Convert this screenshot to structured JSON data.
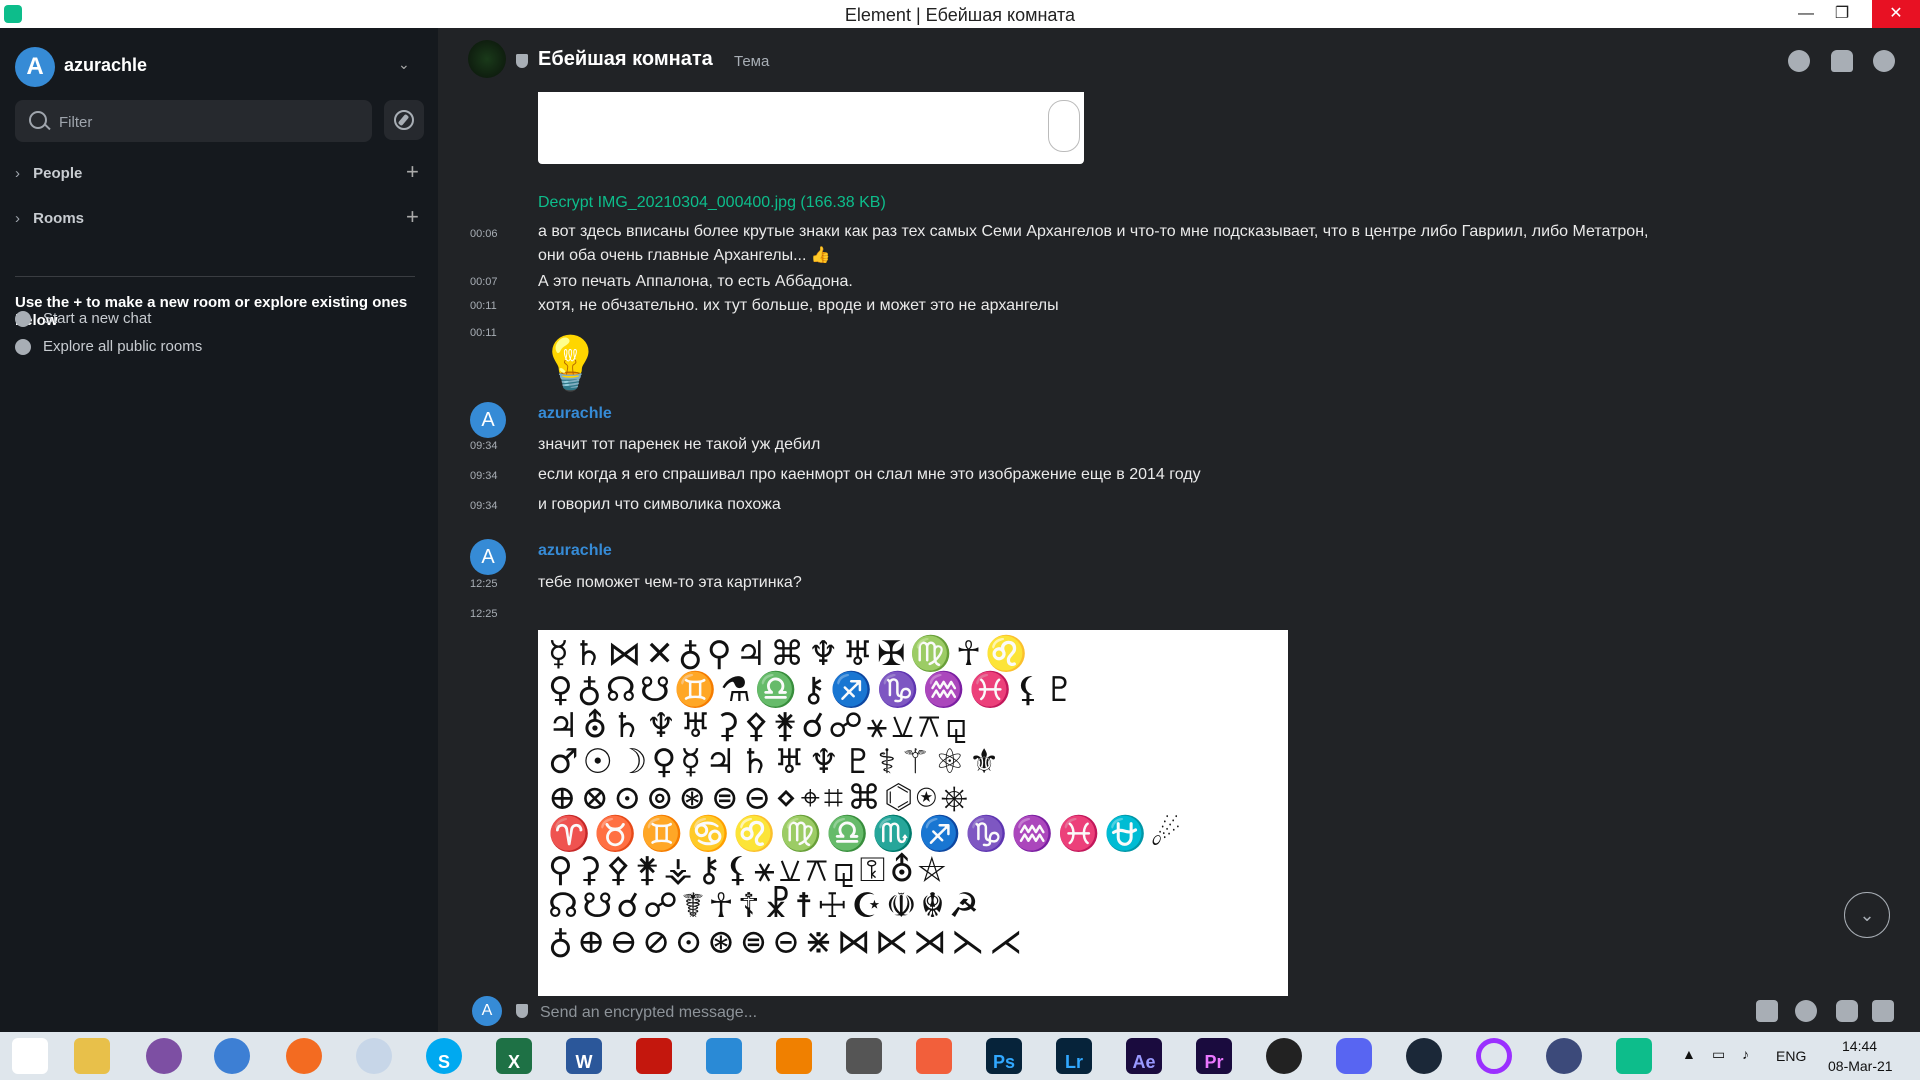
{
  "window": {
    "title": "Element | Ебейшая комната",
    "minimize": "—",
    "maximize": "❐",
    "close": "✕"
  },
  "sidebar": {
    "username": "azurachle",
    "avatar_letter": "A",
    "filter_placeholder": "Filter",
    "sections": [
      {
        "label": "People"
      },
      {
        "label": "Rooms"
      }
    ],
    "hint_title": "Use the + to make a new room or explore existing ones below",
    "actions": [
      {
        "label": "Start a new chat"
      },
      {
        "label": "Explore all public rooms"
      }
    ]
  },
  "room": {
    "name": "Ебейшая комната",
    "topic": "Тема"
  },
  "timeline": {
    "file_link": "Decrypt IMG_20210304_000400.jpg (166.38 KB)",
    "messages": [
      {
        "time": "00:06",
        "text": "а вот здесь вписаны более крутые знаки как раз тех самых Семи Архангелов и что-то мне подсказывает, что в центре либо Гавриил, либо Метатрон,",
        "text2": "они оба очень главные Архангелы... 👍"
      },
      {
        "time": "00:07",
        "text": "А это печать Аппалона, то есть Аббадона."
      },
      {
        "time": "00:11",
        "text": "хотя, не обчзательно. их тут больше, вроде и может это не архангелы"
      },
      {
        "time": "00:11",
        "emoji": "💡"
      }
    ],
    "group1": {
      "sender": "azurachle",
      "messages": [
        {
          "time": "09:34",
          "text": "значит тот паренек не такой уж дебил"
        },
        {
          "time": "09:34",
          "text": "если когда я его спрашивал про каенморт он слал мне это изображение еще в 2014 году"
        },
        {
          "time": "09:34",
          "text": "и говорил что символика похожа"
        }
      ]
    },
    "group2": {
      "sender": "azurachle",
      "messages": [
        {
          "time": "12:25",
          "text": "тебе поможет чем-то эта картинка?"
        },
        {
          "time": "12:25"
        }
      ],
      "symbols_image": "☿♄⋈✕♁⚲♃⌘♆♅✠♍☥♌\n♀♁☊☋♊⚗♎⚷♐♑♒♓⚸♇\n♃⛢♄♆♅⚳⚴⚵☌☍⚹⚺⚻⚼\n♂☉☽♀☿♃♄♅♆♇⚕⚚⚛⚜\n⊕⊗⊙⊚⊛⊜⊝⋄⌖⌗⌘⌬⍟⎈\n♈♉♊♋♌♍♎♏♐♑♒♓⛎☄\n⚲⚳⚴⚵⚶⚷⚸⚹⚺⚻⚼⚿⛢⛤\n☊☋☌☍☤☥☦☧☨☩☪☫☬☭\n♁⊕⊖⊘⊙⊛⊜⊝⋇⋈⋉⋊⋋⋌"
    }
  },
  "composer": {
    "placeholder": "Send an encrypted message..."
  },
  "taskbar": {
    "apps": [
      "start",
      "explorer",
      "tor",
      "browser",
      "firefox",
      "app",
      "skype",
      "excel",
      "word",
      "acrobat",
      "vscode",
      "vlc",
      "download",
      "sublime",
      "photoshop",
      "lightroom",
      "aftereffects",
      "premiere",
      "obs",
      "discord",
      "steam",
      "cortana",
      "keepass",
      "element"
    ],
    "labels": {
      "skype": "S",
      "excel": "X",
      "word": "W",
      "photoshop": "Ps",
      "lightroom": "Lr",
      "aftereffects": "Ae",
      "premiere": "Pr"
    },
    "lang": "ENG",
    "time": "14:44",
    "date": "08-Mar-21"
  },
  "colors": {
    "accent": "#0dbd8b",
    "sender": "#368bd6",
    "panel": "#15191e",
    "main": "#212326"
  }
}
